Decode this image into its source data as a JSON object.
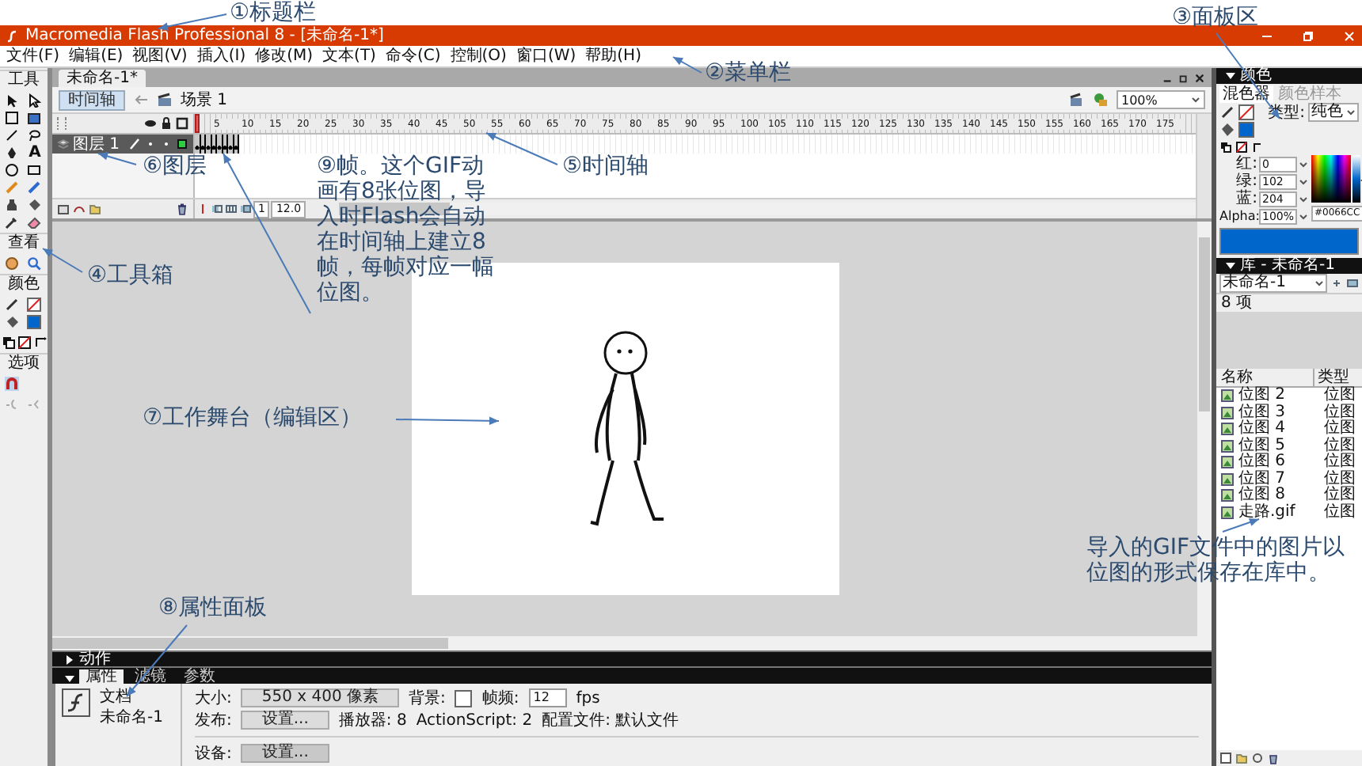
{
  "window": {
    "title": "Macromedia Flash Professional 8 - [未命名-1*]"
  },
  "menu": [
    "文件(F)",
    "编辑(E)",
    "视图(V)",
    "插入(I)",
    "修改(M)",
    "文本(T)",
    "命令(C)",
    "控制(O)",
    "窗口(W)",
    "帮助(H)"
  ],
  "toolbox": {
    "title": "工具",
    "text_tool": "A",
    "sections": [
      "查看",
      "颜色",
      "选项"
    ]
  },
  "document": {
    "tab": "未命名-1*",
    "timeline_button": "时间轴",
    "scene": "场景 1",
    "zoom": "100%"
  },
  "timeline": {
    "ruler": [
      "5",
      "10",
      "15",
      "20",
      "25",
      "30",
      "35",
      "40",
      "45",
      "50",
      "55",
      "60",
      "65",
      "70",
      "75",
      "80",
      "85",
      "90",
      "95",
      "100",
      "105",
      "110",
      "115",
      "120",
      "125",
      "130",
      "135",
      "140",
      "145",
      "150",
      "155",
      "160",
      "165",
      "170",
      "175"
    ],
    "layers": [
      {
        "name": "图层 1",
        "selected": true,
        "frames": [
          {
            "keyframe": true
          },
          {
            "keyframe": true
          },
          {
            "keyframe": true
          },
          {
            "keyframe": true
          },
          {
            "keyframe": true
          },
          {
            "keyframe": true
          },
          {
            "keyframe": true
          },
          {
            "keyframe": true
          }
        ]
      }
    ],
    "current_frame": "1",
    "frame_rate": "12.0"
  },
  "actions_panel": {
    "title": "动作",
    "expanded": false
  },
  "properties": {
    "tabs": [
      {
        "label": "属性",
        "selected": true
      },
      {
        "label": "滤镜",
        "selected": false
      },
      {
        "label": "参数",
        "selected": false
      }
    ],
    "doc_type": "文档",
    "doc_name": "未命名-1",
    "size_label": "大小:",
    "size_value": "550 x 400 像素",
    "bg_label": "背景:",
    "fps_label": "帧频:",
    "fps_value": "12",
    "fps_unit": "fps",
    "publish_label": "发布:",
    "publish_button": "设置...",
    "player": "播放器: 8",
    "actionscript": "ActionScript: 2",
    "profile": "配置文件: 默认文件",
    "device_label": "设备:",
    "device_button": "设置..."
  },
  "color_panel": {
    "title": "颜色",
    "tabs": [
      {
        "label": "混色器",
        "selected": true
      },
      {
        "label": "颜色样本",
        "selected": false
      }
    ],
    "type_label": "类型:",
    "type_value": "纯色",
    "channels": [
      {
        "label": "红:",
        "value": "0"
      },
      {
        "label": "绿:",
        "value": "102"
      },
      {
        "label": "蓝:",
        "value": "204"
      },
      {
        "label": "Alpha:",
        "value": "100%"
      }
    ],
    "brightness": {
      "level": 0.45
    },
    "hex": "#0066CC",
    "color": "#0066cc"
  },
  "library": {
    "title": "库 - 未命名-1",
    "document": "未命名-1",
    "count": "8 项",
    "columns": [
      "名称",
      "类型"
    ],
    "items": [
      {
        "name": "位图 2",
        "type": "位图"
      },
      {
        "name": "位图 3",
        "type": "位图"
      },
      {
        "name": "位图 4",
        "type": "位图"
      },
      {
        "name": "位图 5",
        "type": "位图"
      },
      {
        "name": "位图 6",
        "type": "位图"
      },
      {
        "name": "位图 7",
        "type": "位图"
      },
      {
        "name": "位图 8",
        "type": "位图"
      },
      {
        "name": "走路.gif",
        "type": "位图"
      }
    ]
  },
  "annotations": [
    {
      "text": "①标题栏"
    },
    {
      "text": "③面板区"
    },
    {
      "text": "②菜单栏"
    },
    {
      "text": "⑥图层"
    },
    {
      "text": "⑨帧。这个GIF动画有8张位图，导入时Flash会自动在时间轴上建立8帧，每帧对应一幅位图。"
    },
    {
      "text": "⑤时间轴"
    },
    {
      "text": "④工具箱"
    },
    {
      "text": "⑦工作舞台（编辑区）"
    },
    {
      "text": "导入的GIF文件中的图片以位图的形式保存在库中。"
    },
    {
      "text": "⑧属性面板"
    }
  ]
}
